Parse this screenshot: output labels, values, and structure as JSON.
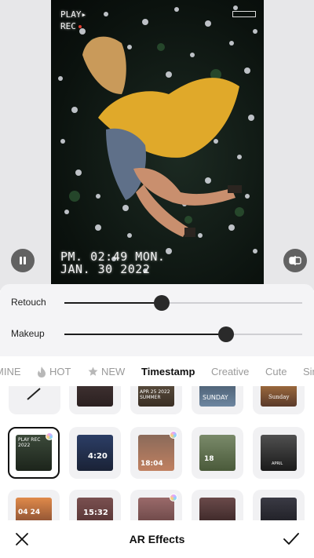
{
  "preview": {
    "overlay": {
      "play": "PLAY▸",
      "rec": "REC",
      "time": "PM. 02:49 MON.",
      "date": "JAN. 30 2022"
    },
    "pause_icon": "pause-icon",
    "compare_icon": "compare-icon"
  },
  "sliders": [
    {
      "label": "Retouch",
      "value_pct": 41
    },
    {
      "label": "Makeup",
      "value_pct": 68
    }
  ],
  "tabs": [
    {
      "label": "MINE",
      "icon": ""
    },
    {
      "label": "HOT",
      "icon": "flame-icon"
    },
    {
      "label": "NEW",
      "icon": "star-icon"
    },
    {
      "label": "Timestamp",
      "icon": "",
      "active": true
    },
    {
      "label": "Creative",
      "icon": ""
    },
    {
      "label": "Cute",
      "icon": ""
    },
    {
      "label": "Sim",
      "icon": ""
    }
  ],
  "grid": {
    "row1": [
      "",
      "",
      "APR 25 2022 SUMMER",
      "SUNDAY",
      "Sunday"
    ],
    "row2": [
      "PLAY REC 2022",
      "4:20",
      "18:04",
      "18",
      "APRIL"
    ],
    "row3": [
      "04 24",
      "15:32",
      "",
      "",
      ""
    ]
  },
  "bottom": {
    "title": "AR Effects",
    "close_icon": "close-icon",
    "confirm_icon": "checkmark-icon"
  },
  "colors": {
    "accent_dark": "#1c1c1c",
    "track": "#cfcfd3",
    "tab_inactive": "#9a9a9a"
  }
}
